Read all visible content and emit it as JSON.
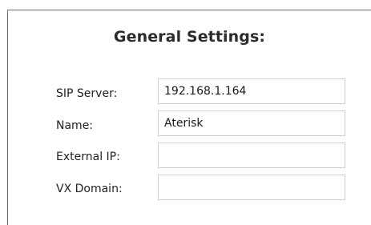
{
  "section": {
    "title": "General Settings:"
  },
  "fields": {
    "sip_server": {
      "label": "SIP Server:",
      "value": "192.168.1.164"
    },
    "name": {
      "label": "Name:",
      "value": "Aterisk"
    },
    "external_ip": {
      "label": "External IP:",
      "value": ""
    },
    "vx_domain": {
      "label": "VX Domain:",
      "value": ""
    }
  }
}
